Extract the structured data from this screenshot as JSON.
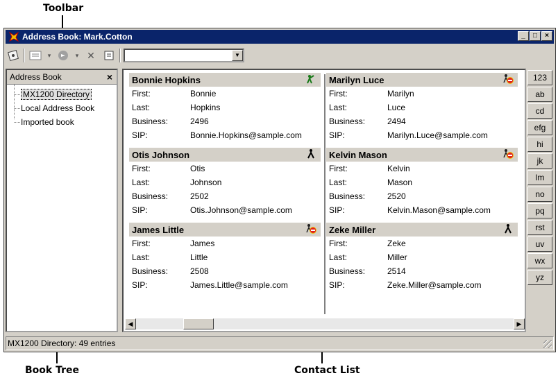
{
  "annotations": {
    "toolbar": "Toolbar",
    "book_tree": "Book Tree",
    "contact_list": "Contact List"
  },
  "window": {
    "title": "Address Book: Mark.Cotton"
  },
  "sidebar": {
    "header": "Address Book",
    "close": "×",
    "items": [
      {
        "label": "MX1200 Directory",
        "selected": true
      },
      {
        "label": "Local Address Book"
      },
      {
        "label": "Imported book"
      }
    ]
  },
  "contacts": {
    "field_labels": {
      "first": "First:",
      "last": "Last:",
      "business": "Business:",
      "sip": "SIP:"
    },
    "left": [
      {
        "name": "Bonnie Hopkins",
        "first": "Bonnie",
        "last": "Hopkins",
        "business": "2496",
        "sip": "Bonnie.Hopkins@sample.com",
        "status": "available"
      },
      {
        "name": "Otis Johnson",
        "first": "Otis",
        "last": "Johnson",
        "business": "2502",
        "sip": "Otis.Johnson@sample.com",
        "status": "offline"
      },
      {
        "name": "James Little",
        "first": "James",
        "last": "Little",
        "business": "2508",
        "sip": "James.Little@sample.com",
        "status": "busy"
      }
    ],
    "right": [
      {
        "name": "Marilyn Luce",
        "first": "Marilyn",
        "last": "Luce",
        "business": "2494",
        "sip": "Marilyn.Luce@sample.com",
        "status": "busy"
      },
      {
        "name": "Kelvin Mason",
        "first": "Kelvin",
        "last": "Mason",
        "business": "2520",
        "sip": "Kelvin.Mason@sample.com",
        "status": "busy"
      },
      {
        "name": "Zeke Miller",
        "first": "Zeke",
        "last": "Miller",
        "business": "2514",
        "sip": "Zeke.Miller@sample.com",
        "status": "offline"
      }
    ]
  },
  "index_buttons": [
    "123",
    "ab",
    "cd",
    "efg",
    "hi",
    "jk",
    "lm",
    "no",
    "pq",
    "rst",
    "uv",
    "wx",
    "yz"
  ],
  "status": {
    "text": "MX1200 Directory: 49 entries"
  },
  "colors": {
    "titlebar": "#0a246a",
    "available": "#1a7a1a",
    "busy": "#e02020",
    "offline": "#000000"
  }
}
